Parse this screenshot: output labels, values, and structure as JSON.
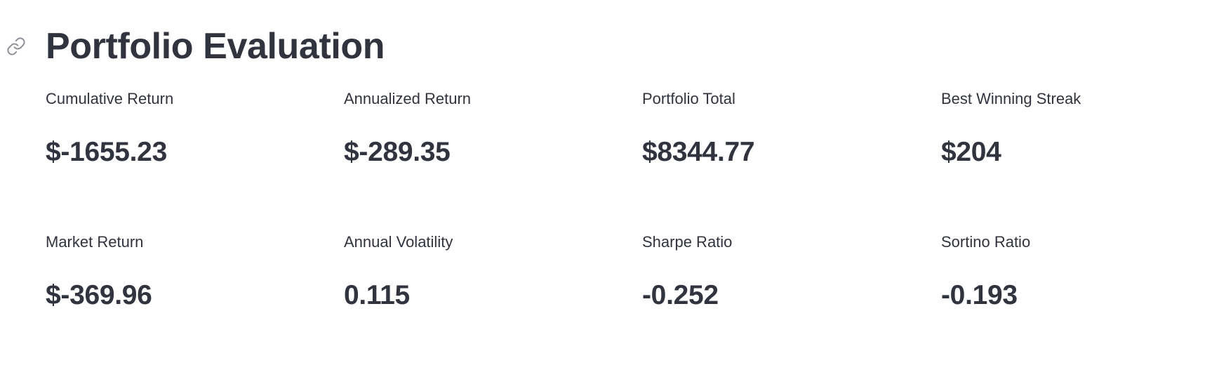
{
  "header": {
    "title": "Portfolio Evaluation",
    "anchor_icon": "link-icon"
  },
  "metrics": [
    {
      "label": "Cumulative Return",
      "value": "$-1655.23"
    },
    {
      "label": "Annualized Return",
      "value": "$-289.35"
    },
    {
      "label": "Portfolio Total",
      "value": "$8344.77"
    },
    {
      "label": "Best Winning Streak",
      "value": "$204"
    },
    {
      "label": "Market Return",
      "value": "$-369.96"
    },
    {
      "label": "Annual Volatility",
      "value": "0.115"
    },
    {
      "label": "Sharpe Ratio",
      "value": "-0.252"
    },
    {
      "label": "Sortino Ratio",
      "value": "-0.193"
    }
  ],
  "colors": {
    "text": "#31333f",
    "icon": "#8a8c94",
    "background": "#ffffff"
  }
}
